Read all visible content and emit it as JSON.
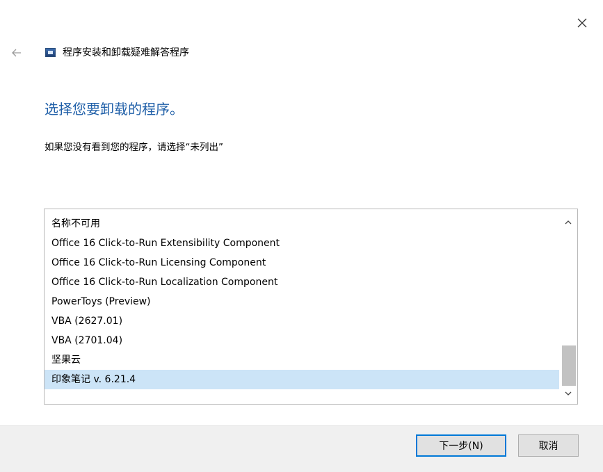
{
  "window": {
    "title": "程序安装和卸载疑难解答程序",
    "close_icon": "close-icon",
    "back_icon": "back-arrow-icon",
    "app_icon": "troubleshooter-icon"
  },
  "main": {
    "heading": "选择您要卸载的程序。",
    "instruction": "如果您没有看到您的程序，请选择“未列出”"
  },
  "program_list": {
    "items": [
      {
        "label": "名称不可用"
      },
      {
        "label": "Office 16 Click-to-Run Extensibility Component"
      },
      {
        "label": "Office 16 Click-to-Run Licensing Component"
      },
      {
        "label": "Office 16 Click-to-Run Localization Component"
      },
      {
        "label": "PowerToys (Preview)"
      },
      {
        "label": "VBA (2627.01)"
      },
      {
        "label": "VBA (2701.04)"
      },
      {
        "label": "坚果云"
      },
      {
        "label": "印象笔记 v. 6.21.4"
      }
    ],
    "selected_index": 8
  },
  "footer": {
    "next_label": "下一步(N)",
    "cancel_label": "取消"
  },
  "colors": {
    "heading": "#1f5fa8",
    "selection": "#cce4f7",
    "default_button_border": "#0078d7"
  }
}
